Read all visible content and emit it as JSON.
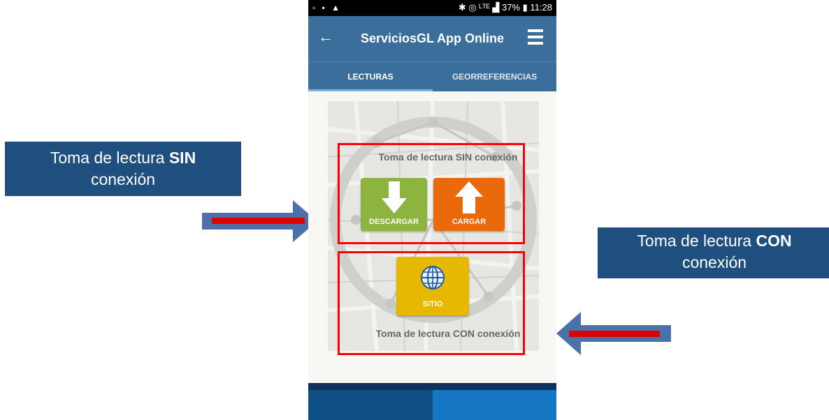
{
  "callouts": {
    "left": {
      "prefix": "Toma de lectura ",
      "bold": "SIN",
      "suffix": "conexión"
    },
    "right": {
      "prefix": "Toma de lectura ",
      "bold": "CON",
      "suffix": "conexión"
    }
  },
  "status_bar": {
    "left_icons": "▫ ▪ ▲",
    "right": "✱ ◎ ᴸᵀᴱ ▟ 37% ▮ 11:28"
  },
  "app_bar": {
    "back_icon": "back-arrow-icon",
    "title": "ServiciosGL App Online",
    "menu_icon": "hamburger-menu-icon"
  },
  "tabs": [
    {
      "label": "LECTURAS",
      "active": true
    },
    {
      "label": "GEORREFERENCIAS",
      "active": false
    }
  ],
  "content": {
    "sin_label": "Toma de lectura SIN conexión",
    "con_label": "Toma de lectura CON conexión",
    "buttons": {
      "descargar": "DESCARGAR",
      "cargar": "CARGAR",
      "sitio": "SITIO"
    }
  },
  "colors": {
    "app_blue": "#3b6e9b",
    "callout_blue": "#1f4f7f",
    "descargar_green": "#8cb43f",
    "cargar_orange": "#ea6a0b",
    "sitio_yellow": "#e6b900",
    "highlight_red": "#ff0000"
  }
}
